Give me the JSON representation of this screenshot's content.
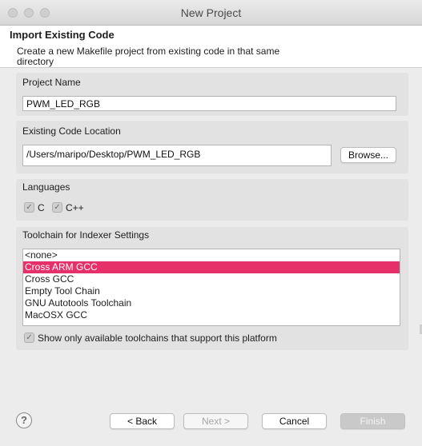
{
  "window": {
    "title": "New Project"
  },
  "banner": {
    "title": "Import Existing Code",
    "description": "Create a new Makefile project from existing code in that same directory"
  },
  "project_name": {
    "label": "Project Name",
    "value": "PWM_LED_RGB"
  },
  "code_location": {
    "label": "Existing Code Location",
    "value": "/Users/maripo/Desktop/PWM_LED_RGB",
    "browse_label": "Browse..."
  },
  "languages": {
    "label": "Languages",
    "items": [
      {
        "label": "C",
        "checked": true
      },
      {
        "label": "C++",
        "checked": true
      }
    ]
  },
  "toolchain": {
    "label": "Toolchain for Indexer Settings",
    "items": [
      "<none>",
      "Cross ARM GCC",
      "Cross GCC",
      "Empty Tool Chain",
      "GNU Autotools Toolchain",
      "MacOSX GCC"
    ],
    "selected": "Cross ARM GCC",
    "selected_color": "#e5306a",
    "show_only_label": "Show only available toolchains that support this platform",
    "show_only_checked": true
  },
  "footer": {
    "help_glyph": "?",
    "back_label": "< Back",
    "next_label": "Next >",
    "cancel_label": "Cancel",
    "finish_label": "Finish"
  }
}
